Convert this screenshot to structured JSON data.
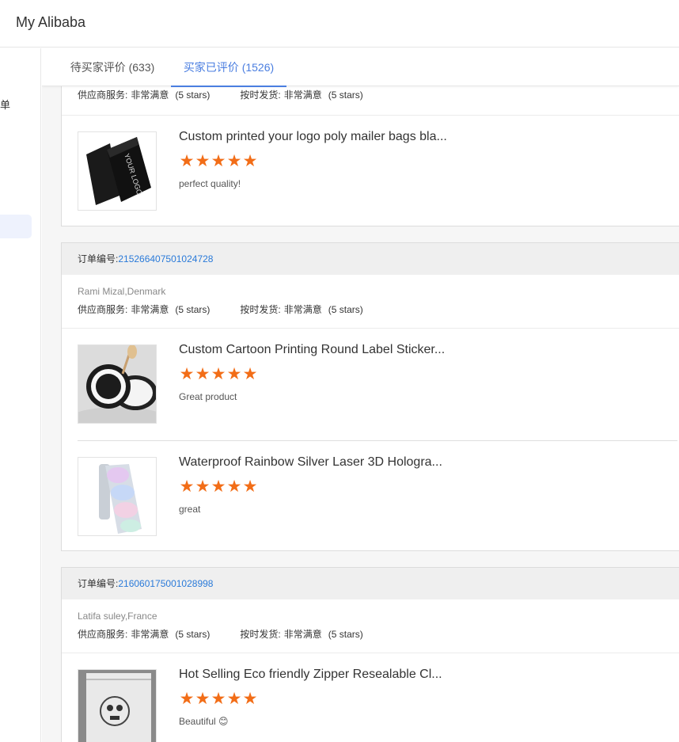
{
  "app": {
    "title": "My Alibaba"
  },
  "sidebar": {
    "partial_label": "单"
  },
  "tabs": [
    {
      "label": "待买家评价 (633)",
      "active": false
    },
    {
      "label": "买家已评价 (1526)",
      "active": true
    }
  ],
  "labels": {
    "order_no": "订单编号:",
    "supplier_service": "供应商服务:",
    "on_time_delivery": "按时发货:",
    "very_satisfied": "非常满意",
    "five_stars": "(5 stars)"
  },
  "colors": {
    "accent": "#4a7ee0",
    "star": "#f26d17",
    "link": "#2a7ad9"
  },
  "orders": [
    {
      "order_id": "",
      "buyer": "",
      "items": [
        {
          "title": "Custom printed your logo poly mailer bags bla...",
          "rating": 5,
          "comment": "perfect quality!",
          "image": "black-mailer-bags"
        }
      ]
    },
    {
      "order_id": "215266407501024728",
      "buyer": "Rami Mizal,Denmark",
      "items": [
        {
          "title": "Custom Cartoon Printing Round Label Sticker...",
          "rating": 5,
          "comment": "Great product",
          "image": "round-label-stickers"
        },
        {
          "title": "Waterproof Rainbow Silver Laser 3D Hologra...",
          "rating": 5,
          "comment": "great",
          "image": "holographic-sticker-roll"
        }
      ]
    },
    {
      "order_id": "216060175001028998",
      "buyer": "Latifa suley,France",
      "items": [
        {
          "title": "Hot Selling Eco friendly Zipper Resealable Cl...",
          "rating": 5,
          "comment": "Beautiful 😊",
          "image": "zipper-clear-bag"
        }
      ]
    }
  ]
}
